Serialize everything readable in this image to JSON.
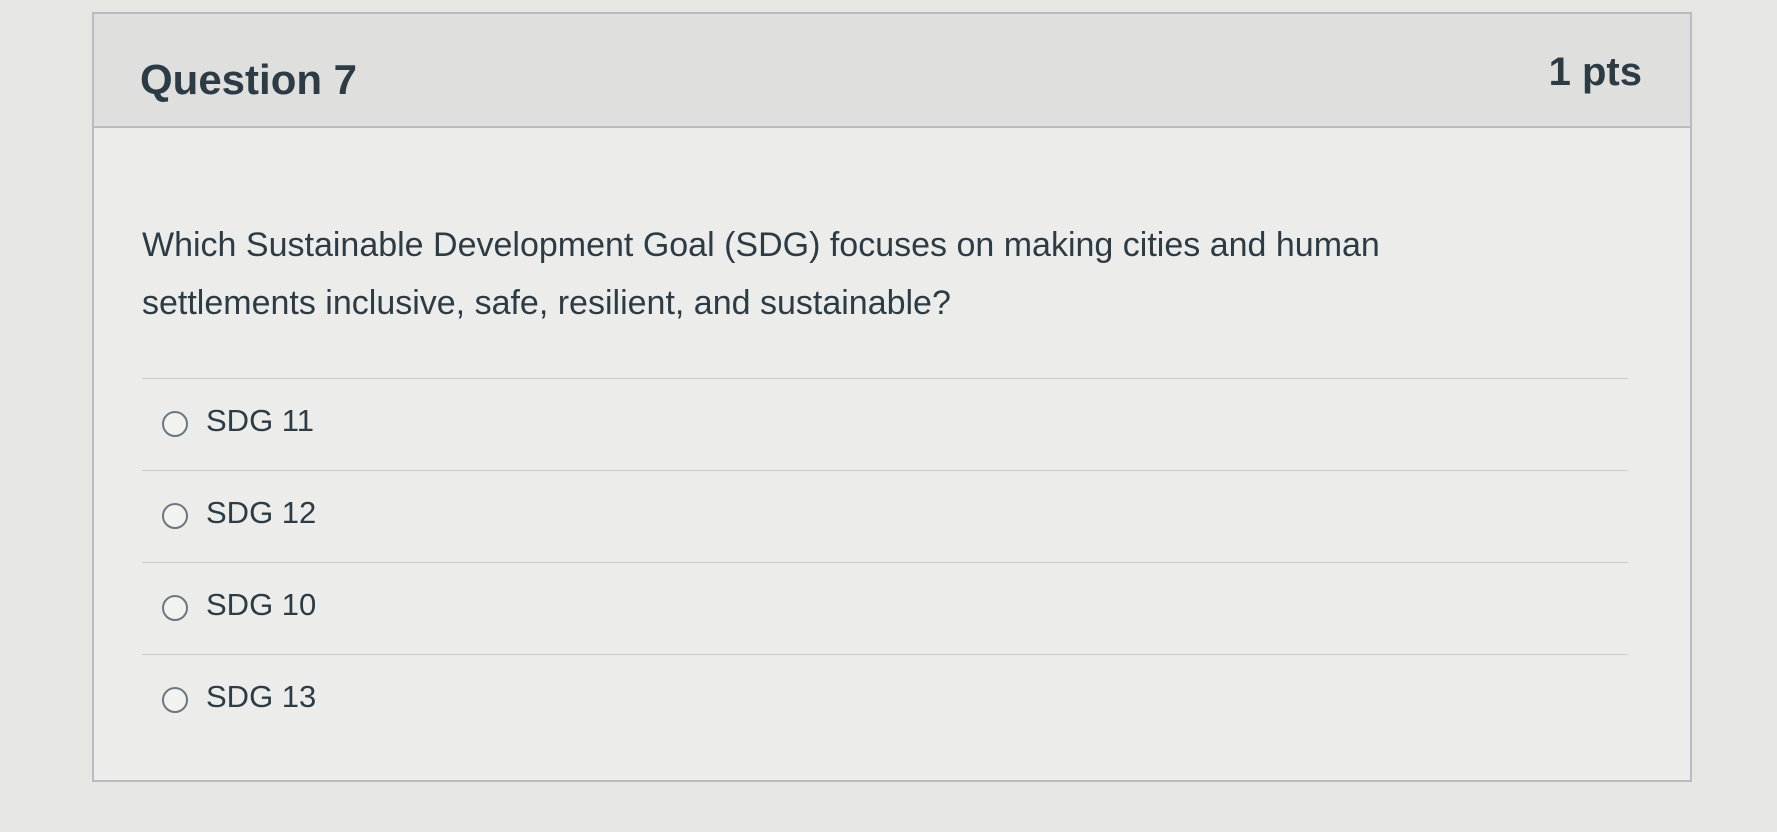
{
  "question": {
    "title": "Question 7",
    "points": "1 pts",
    "text": "Which Sustainable Development Goal (SDG) focuses on making cities and human settlements inclusive, safe, resilient, and sustainable?",
    "answers": [
      {
        "label": "SDG 11"
      },
      {
        "label": "SDG 12"
      },
      {
        "label": "SDG 10"
      },
      {
        "label": "SDG 13"
      }
    ]
  }
}
